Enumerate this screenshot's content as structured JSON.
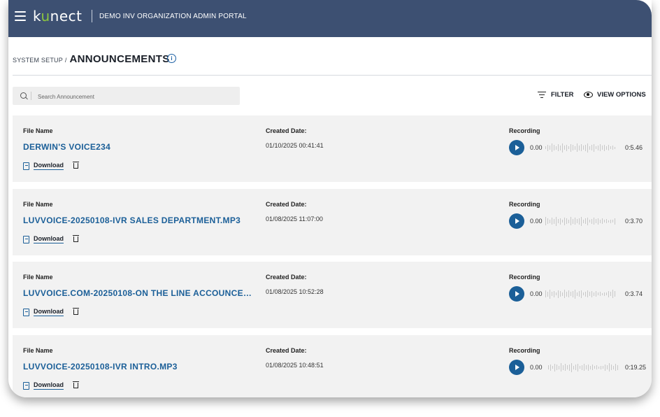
{
  "header": {
    "logo_prefix": "k",
    "logo_accent": "u",
    "logo_suffix": "nect",
    "portal_title": "DEMO INV ORGANIZATION ADMIN PORTAL"
  },
  "breadcrumb": {
    "parent": "SYSTEM SETUP",
    "separator": "/",
    "current": "ANNOUNCEMENTS"
  },
  "search": {
    "placeholder": "Search Announcement",
    "value": ""
  },
  "toolbar": {
    "filter_label": "FILTER",
    "view_options_label": "VIEW OPTIONS"
  },
  "labels": {
    "file_name": "File Name",
    "created_date": "Created Date:",
    "recording": "Recording",
    "download": "Download"
  },
  "announcements": [
    {
      "file_name": "DERWIN'S VOICE234",
      "created_date": "01/10/2025 00:41:41",
      "current_time": "0.00",
      "duration": "0:5.46"
    },
    {
      "file_name": "LUVVOICE-20250108-IVR SALES DEPARTMENT.MP3",
      "created_date": "01/08/2025 11:07:00",
      "current_time": "0.00",
      "duration": "0:3.70"
    },
    {
      "file_name": "LUVVOICE.COM-20250108-ON THE LINE ACCOUNCEM...",
      "created_date": "01/08/2025 10:52:28",
      "current_time": "0.00",
      "duration": "0:3.74"
    },
    {
      "file_name": "LUVVOICE-20250108-IVR INTRO.MP3",
      "created_date": "01/08/2025 10:48:51",
      "current_time": "0.00",
      "duration": "0:19.25"
    }
  ],
  "colors": {
    "header_bg": "#3d5072",
    "accent": "#1b5f98",
    "logo_accent": "#8cc63f",
    "card_bg": "#f2f2f2"
  }
}
